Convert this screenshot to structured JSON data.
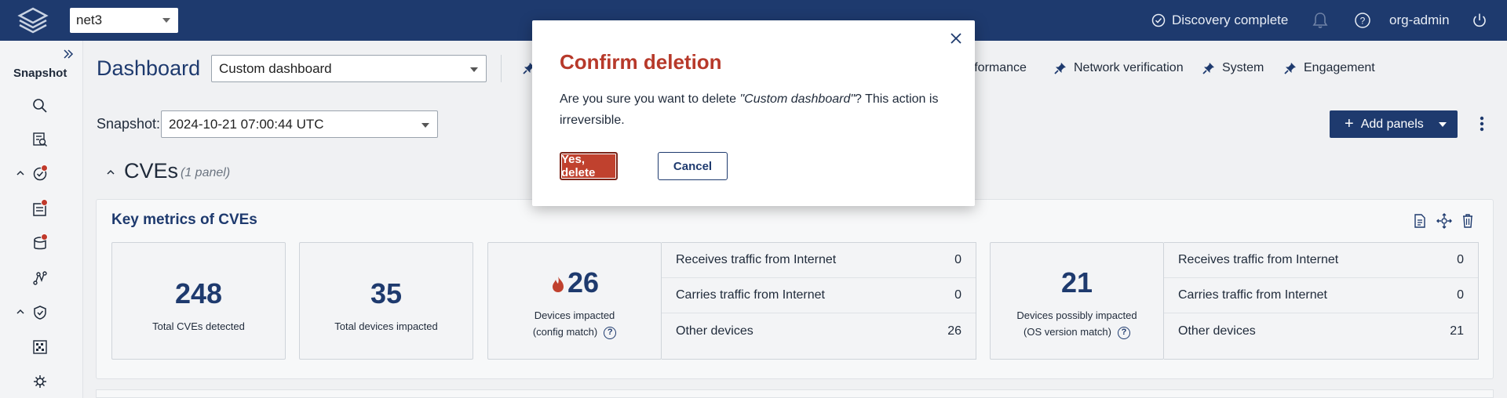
{
  "topbar": {
    "network": "net3",
    "discovery_status": "Discovery complete",
    "user": "org-admin"
  },
  "sidebar": {
    "section_label": "Snapshot"
  },
  "header": {
    "title": "Dashboard",
    "dashboard_select": "Custom dashboard",
    "tabs": [
      {
        "label": "erformance"
      },
      {
        "label": "Network verification"
      },
      {
        "label": "System"
      },
      {
        "label": "Engagement"
      }
    ]
  },
  "snapshot": {
    "label": "Snapshot:",
    "value": "2024-10-21 07:00:44 UTC"
  },
  "toolbar": {
    "add_panels": "Add panels"
  },
  "section": {
    "title": "CVEs",
    "count": "(1 panel)"
  },
  "panel": {
    "title": "Key metrics of CVEs",
    "metrics": [
      {
        "value": "248",
        "label": "Total CVEs detected"
      },
      {
        "value": "35",
        "label": "Total devices impacted"
      },
      {
        "value": "26",
        "label_line1": "Devices impacted",
        "label_line2": "(config match)"
      },
      {
        "value": "21",
        "label_line1": "Devices possibly impacted",
        "label_line2": "(OS version match)"
      }
    ],
    "config_rows": [
      {
        "label": "Receives traffic from Internet",
        "value": "0"
      },
      {
        "label": "Carries traffic from Internet",
        "value": "0"
      },
      {
        "label": "Other devices",
        "value": "26"
      }
    ],
    "os_rows": [
      {
        "label": "Receives traffic from Internet",
        "value": "0"
      },
      {
        "label": "Carries traffic from Internet",
        "value": "0"
      },
      {
        "label": "Other devices",
        "value": "21"
      }
    ]
  },
  "modal": {
    "title": "Confirm deletion",
    "body_prefix": "Are you sure you want to delete ",
    "body_name": "\"Custom dashboard\"",
    "body_suffix": "? This action is irreversible.",
    "confirm_label": "Yes, delete",
    "cancel_label": "Cancel"
  },
  "colors": {
    "brand": "#1e3a6e",
    "danger": "#c0412e",
    "title_danger": "#b7392a"
  }
}
